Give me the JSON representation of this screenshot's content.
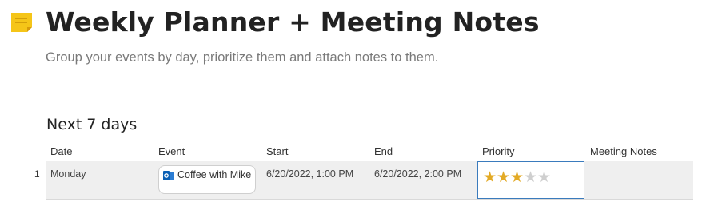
{
  "page": {
    "title": "Weekly Planner + Meeting Notes",
    "subtitle": "Group your events by day, prioritize them and attach notes to them.",
    "icon": "sticky-note-icon",
    "icon_color": "#f5c518"
  },
  "section": {
    "title": "Next 7 days"
  },
  "table": {
    "columns": [
      "Date",
      "Event",
      "Start",
      "End",
      "Priority",
      "Meeting Notes"
    ],
    "rows": [
      {
        "index": "1",
        "date": "Monday",
        "event": "Coffee with Mike",
        "event_icon": "outlook-icon",
        "start": "6/20/2022, 1:00 PM",
        "end": "6/20/2022, 2:00 PM",
        "priority": 3,
        "priority_max": 5,
        "meeting_notes": ""
      }
    ]
  },
  "colors": {
    "star_on": "#e3aa25",
    "star_off": "#cfcfcf",
    "selection": "#3a7bbd"
  }
}
